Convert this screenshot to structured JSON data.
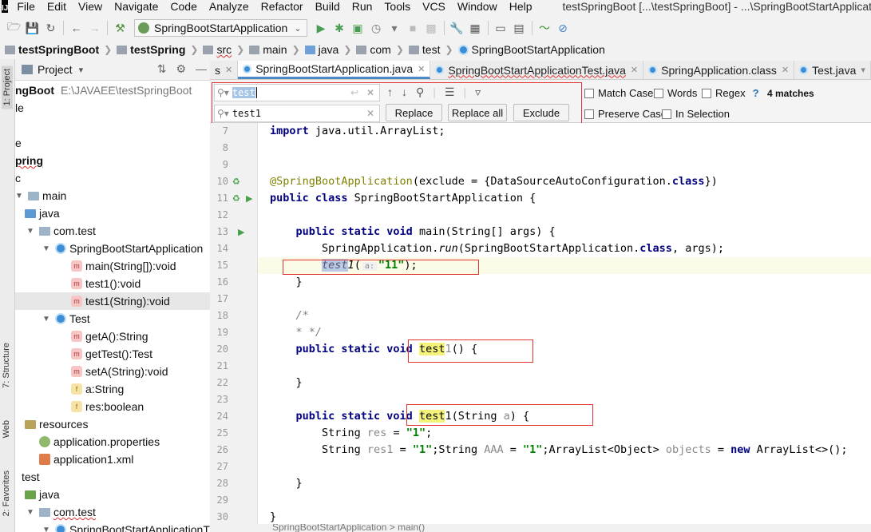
{
  "window": {
    "title": "testSpringBoot [...\\testSpringBoot] - ...\\SpringBootStartApplication.ja",
    "app_logo": "IJ"
  },
  "menu": [
    "File",
    "Edit",
    "View",
    "Navigate",
    "Code",
    "Analyze",
    "Refactor",
    "Build",
    "Run",
    "Tools",
    "VCS",
    "Window",
    "Help"
  ],
  "toolbar": {
    "run_config": "SpringBootStartApplication"
  },
  "breadcrumb": [
    "testSpringBoot",
    "testSpring",
    "src",
    "main",
    "java",
    "com",
    "test",
    "SpringBootStartApplication"
  ],
  "left_strip": {
    "project_tab": "1: Project",
    "structure_tab": "7: Structure",
    "web_tab": "Web",
    "favorites_tab": "2: Favorites"
  },
  "project": {
    "title": "Project",
    "tree": [
      {
        "label": "ngBoot",
        "extra": "E:\\JAVAEE\\testSpringBoot"
      },
      {
        "label": "le"
      },
      {
        "label": "e"
      },
      {
        "label": "pring"
      },
      {
        "label": "c"
      },
      {
        "label": "main"
      },
      {
        "label": "java"
      },
      {
        "label": "com.test"
      },
      {
        "label": "SpringBootStartApplication"
      },
      {
        "label": "main(String[]):void"
      },
      {
        "label": "test1():void"
      },
      {
        "label": "test1(String):void"
      },
      {
        "label": "Test"
      },
      {
        "label": "getA():String"
      },
      {
        "label": "getTest():Test"
      },
      {
        "label": "setA(String):void"
      },
      {
        "label": "a:String"
      },
      {
        "label": "res:boolean"
      },
      {
        "label": "resources"
      },
      {
        "label": "application.properties"
      },
      {
        "label": "application1.xml"
      },
      {
        "label": "test"
      },
      {
        "label": "java"
      },
      {
        "label": "com.test"
      },
      {
        "label": "SpringBootStartApplicationT"
      }
    ]
  },
  "tabs": [
    {
      "label": "s"
    },
    {
      "label": "SpringBootStartApplication.java",
      "active": true
    },
    {
      "label": "SpringBootStartApplicationTest.java"
    },
    {
      "label": "SpringApplication.class"
    },
    {
      "label": "Test.java"
    }
  ],
  "find": {
    "search_value": "test",
    "replace_value": "test1",
    "replace_label": "Replace",
    "replace_all_label": "Replace all",
    "exclude_label": "Exclude",
    "match_case": "Match Case",
    "words": "Words",
    "regex": "Regex",
    "regex_help": "?",
    "matches": "4 matches",
    "preserve_case": "Preserve Case",
    "in_selection": "In Selection"
  },
  "editor": {
    "line_numbers": [
      "7",
      "8",
      "9",
      "10",
      "11",
      "12",
      "13",
      "14",
      "15",
      "16",
      "17",
      "18",
      "19",
      "20",
      "21",
      "22",
      "23",
      "24",
      "25",
      "26",
      "27",
      "28",
      "29",
      "30"
    ],
    "param_hint": "a:"
  },
  "status": {
    "path": "SpringBootStartApplication  >  main()"
  }
}
